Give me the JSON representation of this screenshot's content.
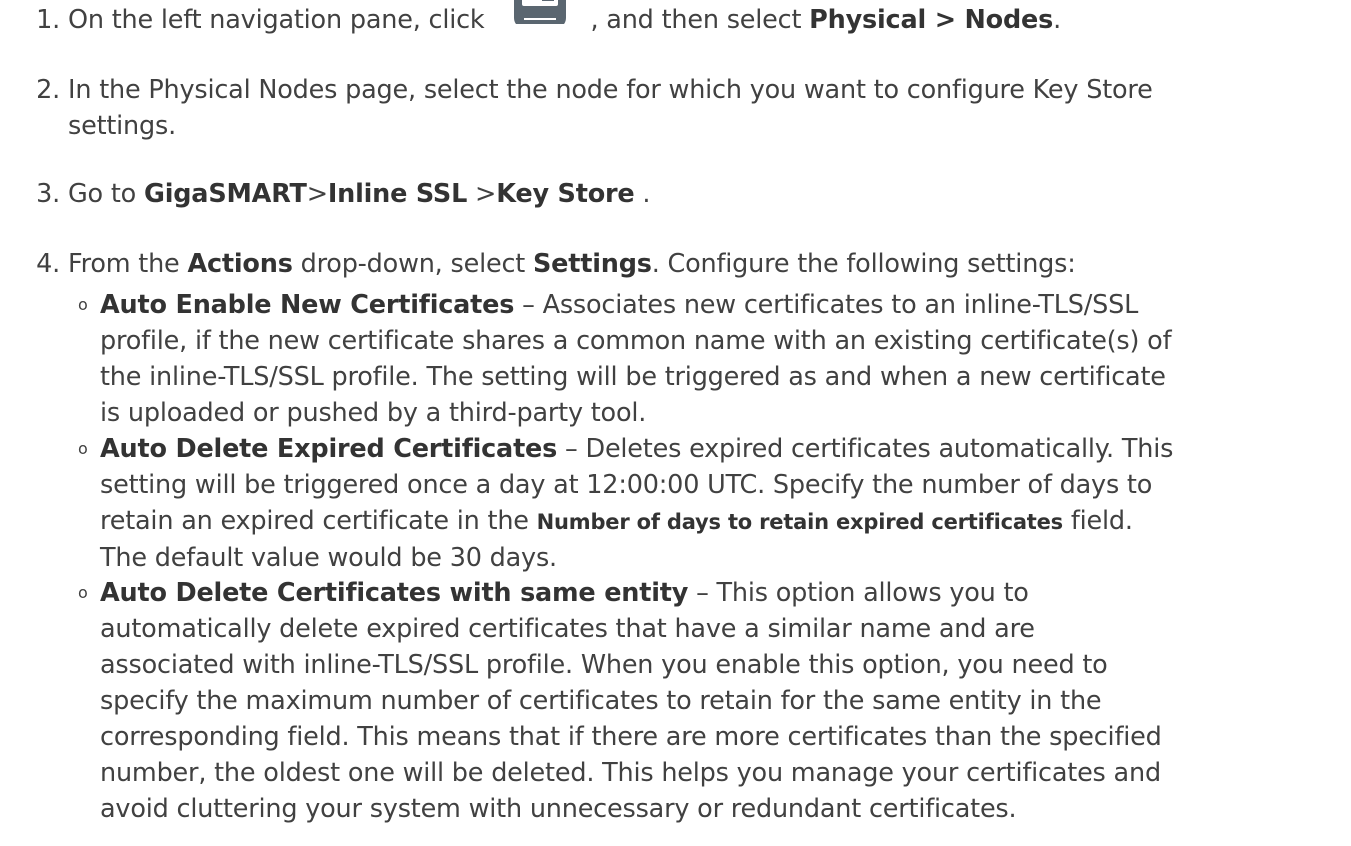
{
  "steps": [
    {
      "number": "1.",
      "pre": "On the left navigation pane, click",
      "icon": "device-icon",
      "post1": ", and then select ",
      "bold": "Physical > Nodes",
      "post2": "."
    },
    {
      "number": "2.",
      "line1": "In the Physical Nodes page, select the node for which you want to configure Key Store",
      "line2": "settings."
    },
    {
      "number": "3.",
      "pre": "Go to ",
      "b1": "GigaSMART",
      "sep1": ">",
      "b2": "Inline SSL",
      "sep2": " >",
      "b3": "Key Store",
      "post": " ."
    },
    {
      "number": "4.",
      "pre": "From the ",
      "b1": "Actions",
      "mid": " drop-down, select ",
      "b2": "Settings",
      "post": ". Configure the following settings:"
    }
  ],
  "bullets": [
    {
      "marker": "o",
      "title": "Auto Enable New Certificates",
      "l1": " – Associates new certificates to an inline-TLS/SSL",
      "l2": "profile, if the new certificate shares a common name with an existing certificate(s) of",
      "l3": "the inline-TLS/SSL profile. The setting will be triggered as and when a new certificate",
      "l4": "is uploaded or pushed by a third-party tool."
    },
    {
      "marker": "o",
      "title": "Auto Delete Expired Certificates",
      "l1": " – Deletes expired certificates automatically. This",
      "l2": "setting will be triggered once a day at 12:00:00 UTC. Specify the number of days to",
      "l3a": "retain an expired certificate in the ",
      "l3b": "Number of days to retain expired certificates",
      "l3c": " field.",
      "l4": "The default value would be 30 days."
    },
    {
      "marker": "o",
      "title": "Auto Delete Certificates with same entity",
      "l1": " – This option allows you to",
      "l2": "automatically delete expired certificates that have a similar name and are",
      "l3": "associated with inline-TLS/SSL profile. When you enable this option, you need to",
      "l4": "specify the maximum number of certificates to retain for the same entity in the",
      "l5": "corresponding field. This means that if there are more certificates than the specified",
      "l6": "number, the oldest one will be deleted. This helps you manage your certificates and",
      "l7": "avoid cluttering your system with unnecessary or redundant certificates."
    }
  ]
}
